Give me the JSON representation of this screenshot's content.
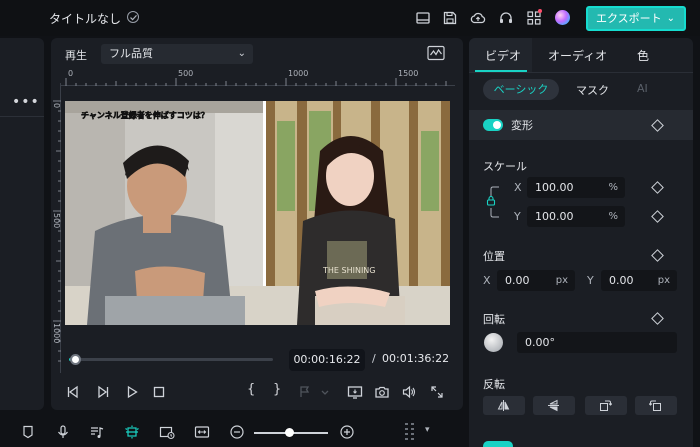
{
  "window": {
    "title": "タイトルなし"
  },
  "header": {
    "export_label": "エクスポート",
    "icons": [
      "layout-icon",
      "save-icon",
      "cloud-upload-icon",
      "headset-icon",
      "apps-grid-icon",
      "avatar-icon"
    ]
  },
  "player": {
    "play_label": "再生",
    "quality": "フル品質",
    "ruler_top": [
      "0",
      "500",
      "1000",
      "1500"
    ],
    "ruler_left": [
      "0",
      "500",
      "1000"
    ],
    "overlay_caption": "チャンネル登録者を伸ばすコツは？",
    "shirt_text": "THE SHINING",
    "current_time": "00:00:16:22",
    "total_time": "00:01:36:22",
    "progress": 0.03,
    "brace_open": "{",
    "brace_close": "}"
  },
  "panel": {
    "tabs": [
      "ビデオ",
      "オーディオ",
      "色"
    ],
    "subtabs": [
      "ベーシック",
      "マスク",
      "AI"
    ],
    "transform": {
      "title": "変形",
      "enabled": true,
      "scale": {
        "label": "スケール",
        "x_axis": "X",
        "y_axis": "Y",
        "x": "100.00",
        "y": "100.00",
        "unit": "%"
      },
      "position": {
        "label": "位置",
        "x_axis": "X",
        "y_axis": "Y",
        "x": "0.00",
        "y": "0.00",
        "unit": "px"
      },
      "rotate": {
        "label": "回転",
        "value": "0.00°"
      },
      "flip": {
        "label": "反転"
      }
    }
  },
  "colors": {
    "accent": "#19d2c4",
    "export_bg": "#23b9b0",
    "panel_bg": "#1b1e24"
  }
}
